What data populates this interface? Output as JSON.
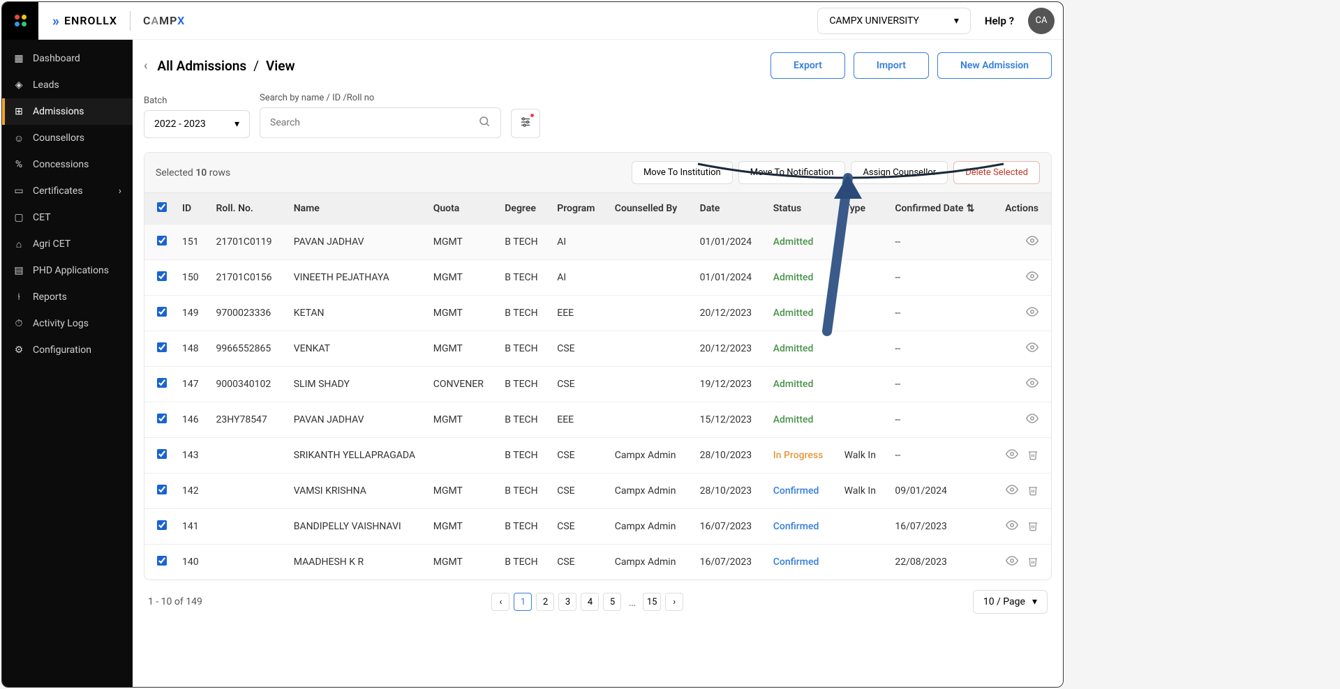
{
  "brand": {
    "enrollx": "ENROLLX",
    "campx": "CAMPX"
  },
  "topbar": {
    "university": "CAMPX UNIVERSITY",
    "help": "Help ?",
    "avatar": "CA"
  },
  "sidebar": {
    "items": [
      {
        "label": "Dashboard"
      },
      {
        "label": "Leads"
      },
      {
        "label": "Admissions"
      },
      {
        "label": "Counsellors"
      },
      {
        "label": "Concessions"
      },
      {
        "label": "Certificates"
      },
      {
        "label": "CET"
      },
      {
        "label": "Agri CET"
      },
      {
        "label": "PHD Applications"
      },
      {
        "label": "Reports"
      },
      {
        "label": "Activity Logs"
      },
      {
        "label": "Configuration"
      }
    ]
  },
  "breadcrumb": {
    "parent": "All Admissions",
    "sep": "/",
    "current": "View"
  },
  "actions": {
    "export": "Export",
    "import": "Import",
    "new": "New Admission"
  },
  "filters": {
    "batch_label": "Batch",
    "batch_value": "2022 - 2023",
    "search_label": "Search by name / ID /Roll no",
    "search_placeholder": "Search"
  },
  "selection": {
    "prefix": "Selected",
    "count": "10",
    "suffix": "rows",
    "move_inst": "Move To Institution",
    "move_notif": "Move To Notification",
    "assign": "Assign Counsellor",
    "delete": "Delete Selected"
  },
  "columns": {
    "id": "ID",
    "roll": "Roll. No.",
    "name": "Name",
    "quota": "Quota",
    "degree": "Degree",
    "program": "Program",
    "counselled": "Counselled By",
    "date": "Date",
    "status": "Status",
    "type": "Type",
    "confirmed": "Confirmed Date",
    "actions": "Actions"
  },
  "rows": [
    {
      "id": "151",
      "roll": "21701C0119",
      "name": "PAVAN JADHAV",
      "quota": "MGMT",
      "degree": "B TECH",
      "program": "AI",
      "counselled": "",
      "date": "01/01/2024",
      "status": "Admitted",
      "status_class": "status-admitted",
      "type": "",
      "confirmed": "--",
      "trash": false
    },
    {
      "id": "150",
      "roll": "21701C0156",
      "name": "VINEETH PEJATHAYA",
      "quota": "MGMT",
      "degree": "B TECH",
      "program": "AI",
      "counselled": "",
      "date": "01/01/2024",
      "status": "Admitted",
      "status_class": "status-admitted",
      "type": "",
      "confirmed": "--",
      "trash": false
    },
    {
      "id": "149",
      "roll": "9700023336",
      "name": "KETAN",
      "quota": "MGMT",
      "degree": "B TECH",
      "program": "EEE",
      "counselled": "",
      "date": "20/12/2023",
      "status": "Admitted",
      "status_class": "status-admitted",
      "type": "",
      "confirmed": "--",
      "trash": false
    },
    {
      "id": "148",
      "roll": "9966552865",
      "name": "VENKAT",
      "quota": "MGMT",
      "degree": "B TECH",
      "program": "CSE",
      "counselled": "",
      "date": "20/12/2023",
      "status": "Admitted",
      "status_class": "status-admitted",
      "type": "",
      "confirmed": "--",
      "trash": false
    },
    {
      "id": "147",
      "roll": "9000340102",
      "name": "SLIM SHADY",
      "quota": "CONVENER",
      "degree": "B TECH",
      "program": "CSE",
      "counselled": "",
      "date": "19/12/2023",
      "status": "Admitted",
      "status_class": "status-admitted",
      "type": "",
      "confirmed": "--",
      "trash": false
    },
    {
      "id": "146",
      "roll": "23HY78547",
      "name": "PAVAN JADHAV",
      "quota": "MGMT",
      "degree": "B TECH",
      "program": "EEE",
      "counselled": "",
      "date": "15/12/2023",
      "status": "Admitted",
      "status_class": "status-admitted",
      "type": "",
      "confirmed": "--",
      "trash": false
    },
    {
      "id": "143",
      "roll": "",
      "name": "SRIKANTH YELLAPRAGADA",
      "quota": "",
      "degree": "B TECH",
      "program": "CSE",
      "counselled": "Campx Admin",
      "date": "28/10/2023",
      "status": "In Progress",
      "status_class": "status-inprogress",
      "type": "Walk In",
      "confirmed": "--",
      "trash": true
    },
    {
      "id": "142",
      "roll": "",
      "name": "VAMSI KRISHNA",
      "quota": "MGMT",
      "degree": "B TECH",
      "program": "CSE",
      "counselled": "Campx Admin",
      "date": "28/10/2023",
      "status": "Confirmed",
      "status_class": "status-confirmed",
      "type": "Walk In",
      "confirmed": "09/01/2024",
      "trash": true
    },
    {
      "id": "141",
      "roll": "",
      "name": "BANDIPELLY VAISHNAVI",
      "quota": "MGMT",
      "degree": "B TECH",
      "program": "CSE",
      "counselled": "Campx Admin",
      "date": "16/07/2023",
      "status": "Confirmed",
      "status_class": "status-confirmed",
      "type": "",
      "confirmed": "16/07/2023",
      "trash": true
    },
    {
      "id": "140",
      "roll": "",
      "name": "MAADHESH K R",
      "quota": "MGMT",
      "degree": "B TECH",
      "program": "CSE",
      "counselled": "Campx Admin",
      "date": "16/07/2023",
      "status": "Confirmed",
      "status_class": "status-confirmed",
      "type": "",
      "confirmed": "22/08/2023",
      "trash": true
    }
  ],
  "footer": {
    "range": "1 - 10 of 149",
    "pages": [
      "1",
      "2",
      "3",
      "4",
      "5",
      "...",
      "15"
    ],
    "page_size": "10 / Page"
  }
}
